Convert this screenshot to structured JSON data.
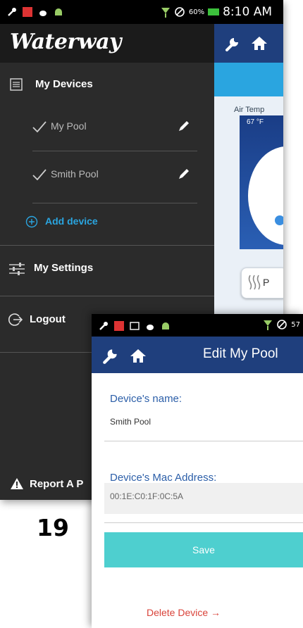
{
  "status_bar": {
    "battery": "60%",
    "time": "8:10 AM"
  },
  "drawer": {
    "brand": "Waterway",
    "my_devices": "My Devices",
    "devices": [
      {
        "name": "My Pool"
      },
      {
        "name": "Smith Pool"
      }
    ],
    "add_device": "Add device",
    "my_settings": "My Settings",
    "logout": "Logout",
    "report": "Report A P"
  },
  "main_partial": {
    "air_temp_label": "Air Temp",
    "air_temp_value": "67 °F",
    "chip_text": "P"
  },
  "page_number": "19",
  "edit_screen": {
    "status_battery": "57",
    "title": "Edit My Pool",
    "device_name_label": "Device's name:",
    "device_name_value": "Smith Pool",
    "mac_label": "Device's Mac Address:",
    "mac_value": "00:1E:C0:1F:0C:5A",
    "save_label": "Save",
    "delete_label": "Delete Device →"
  },
  "colors": {
    "nav_blue": "#1f3f7d",
    "accent_cyan": "#2aa5e0",
    "save_teal": "#4ecfcf",
    "delete_red": "#d9433a"
  }
}
